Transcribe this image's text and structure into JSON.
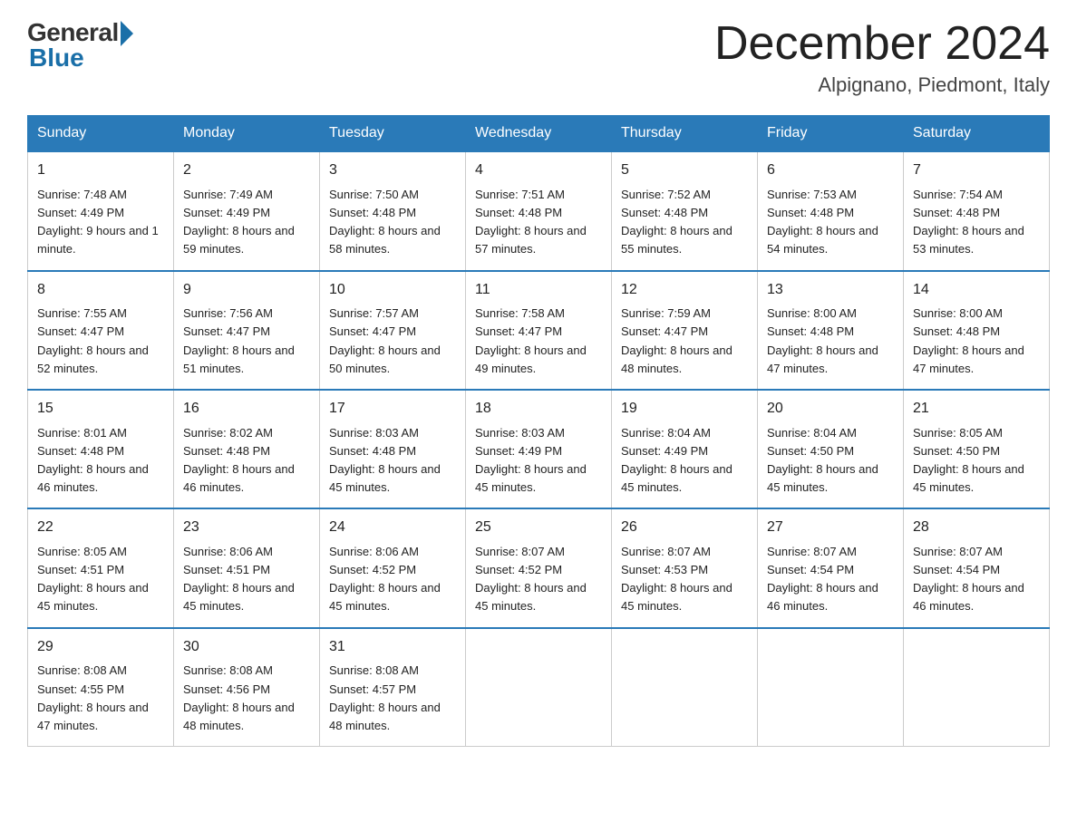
{
  "logo": {
    "general": "General",
    "blue": "Blue"
  },
  "header": {
    "month_year": "December 2024",
    "location": "Alpignano, Piedmont, Italy"
  },
  "days_of_week": [
    "Sunday",
    "Monday",
    "Tuesday",
    "Wednesday",
    "Thursday",
    "Friday",
    "Saturday"
  ],
  "weeks": [
    [
      {
        "day": "1",
        "sunrise": "7:48 AM",
        "sunset": "4:49 PM",
        "daylight": "9 hours and 1 minute."
      },
      {
        "day": "2",
        "sunrise": "7:49 AM",
        "sunset": "4:49 PM",
        "daylight": "8 hours and 59 minutes."
      },
      {
        "day": "3",
        "sunrise": "7:50 AM",
        "sunset": "4:48 PM",
        "daylight": "8 hours and 58 minutes."
      },
      {
        "day": "4",
        "sunrise": "7:51 AM",
        "sunset": "4:48 PM",
        "daylight": "8 hours and 57 minutes."
      },
      {
        "day": "5",
        "sunrise": "7:52 AM",
        "sunset": "4:48 PM",
        "daylight": "8 hours and 55 minutes."
      },
      {
        "day": "6",
        "sunrise": "7:53 AM",
        "sunset": "4:48 PM",
        "daylight": "8 hours and 54 minutes."
      },
      {
        "day": "7",
        "sunrise": "7:54 AM",
        "sunset": "4:48 PM",
        "daylight": "8 hours and 53 minutes."
      }
    ],
    [
      {
        "day": "8",
        "sunrise": "7:55 AM",
        "sunset": "4:47 PM",
        "daylight": "8 hours and 52 minutes."
      },
      {
        "day": "9",
        "sunrise": "7:56 AM",
        "sunset": "4:47 PM",
        "daylight": "8 hours and 51 minutes."
      },
      {
        "day": "10",
        "sunrise": "7:57 AM",
        "sunset": "4:47 PM",
        "daylight": "8 hours and 50 minutes."
      },
      {
        "day": "11",
        "sunrise": "7:58 AM",
        "sunset": "4:47 PM",
        "daylight": "8 hours and 49 minutes."
      },
      {
        "day": "12",
        "sunrise": "7:59 AM",
        "sunset": "4:47 PM",
        "daylight": "8 hours and 48 minutes."
      },
      {
        "day": "13",
        "sunrise": "8:00 AM",
        "sunset": "4:48 PM",
        "daylight": "8 hours and 47 minutes."
      },
      {
        "day": "14",
        "sunrise": "8:00 AM",
        "sunset": "4:48 PM",
        "daylight": "8 hours and 47 minutes."
      }
    ],
    [
      {
        "day": "15",
        "sunrise": "8:01 AM",
        "sunset": "4:48 PM",
        "daylight": "8 hours and 46 minutes."
      },
      {
        "day": "16",
        "sunrise": "8:02 AM",
        "sunset": "4:48 PM",
        "daylight": "8 hours and 46 minutes."
      },
      {
        "day": "17",
        "sunrise": "8:03 AM",
        "sunset": "4:48 PM",
        "daylight": "8 hours and 45 minutes."
      },
      {
        "day": "18",
        "sunrise": "8:03 AM",
        "sunset": "4:49 PM",
        "daylight": "8 hours and 45 minutes."
      },
      {
        "day": "19",
        "sunrise": "8:04 AM",
        "sunset": "4:49 PM",
        "daylight": "8 hours and 45 minutes."
      },
      {
        "day": "20",
        "sunrise": "8:04 AM",
        "sunset": "4:50 PM",
        "daylight": "8 hours and 45 minutes."
      },
      {
        "day": "21",
        "sunrise": "8:05 AM",
        "sunset": "4:50 PM",
        "daylight": "8 hours and 45 minutes."
      }
    ],
    [
      {
        "day": "22",
        "sunrise": "8:05 AM",
        "sunset": "4:51 PM",
        "daylight": "8 hours and 45 minutes."
      },
      {
        "day": "23",
        "sunrise": "8:06 AM",
        "sunset": "4:51 PM",
        "daylight": "8 hours and 45 minutes."
      },
      {
        "day": "24",
        "sunrise": "8:06 AM",
        "sunset": "4:52 PM",
        "daylight": "8 hours and 45 minutes."
      },
      {
        "day": "25",
        "sunrise": "8:07 AM",
        "sunset": "4:52 PM",
        "daylight": "8 hours and 45 minutes."
      },
      {
        "day": "26",
        "sunrise": "8:07 AM",
        "sunset": "4:53 PM",
        "daylight": "8 hours and 45 minutes."
      },
      {
        "day": "27",
        "sunrise": "8:07 AM",
        "sunset": "4:54 PM",
        "daylight": "8 hours and 46 minutes."
      },
      {
        "day": "28",
        "sunrise": "8:07 AM",
        "sunset": "4:54 PM",
        "daylight": "8 hours and 46 minutes."
      }
    ],
    [
      {
        "day": "29",
        "sunrise": "8:08 AM",
        "sunset": "4:55 PM",
        "daylight": "8 hours and 47 minutes."
      },
      {
        "day": "30",
        "sunrise": "8:08 AM",
        "sunset": "4:56 PM",
        "daylight": "8 hours and 48 minutes."
      },
      {
        "day": "31",
        "sunrise": "8:08 AM",
        "sunset": "4:57 PM",
        "daylight": "8 hours and 48 minutes."
      },
      null,
      null,
      null,
      null
    ]
  ],
  "labels": {
    "sunrise": "Sunrise:",
    "sunset": "Sunset:",
    "daylight": "Daylight:"
  }
}
